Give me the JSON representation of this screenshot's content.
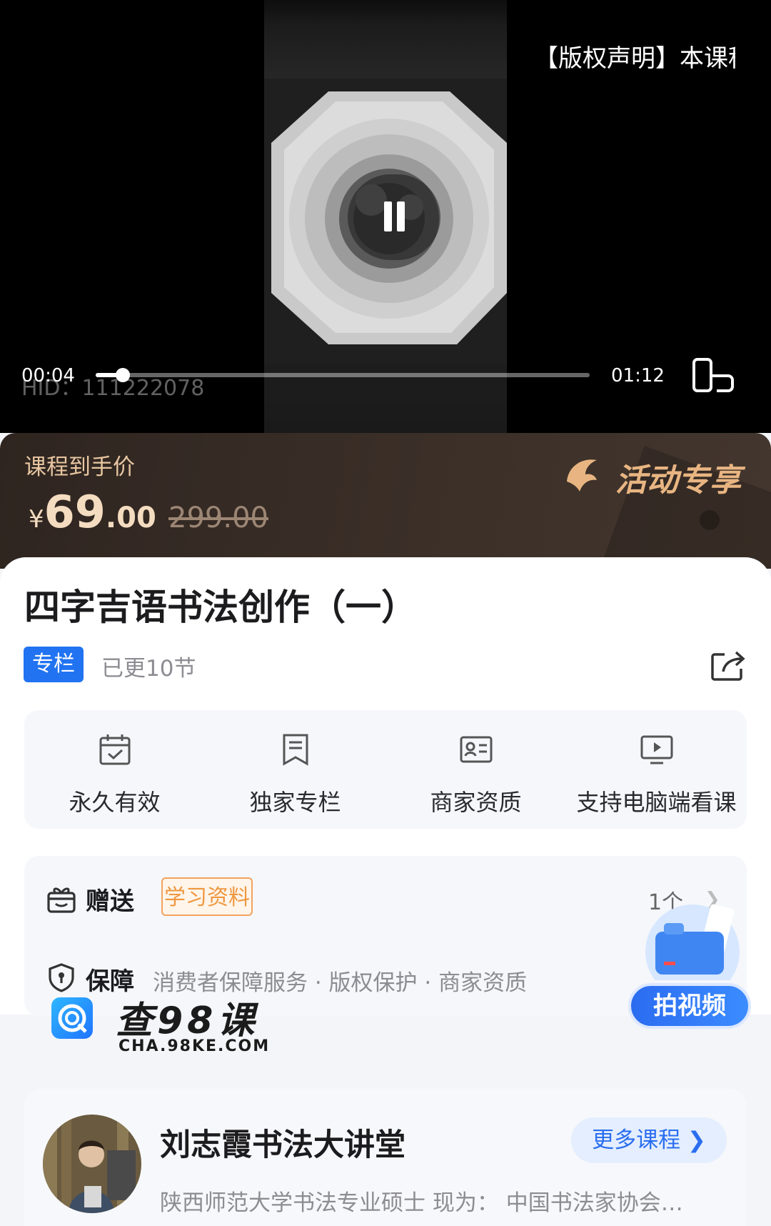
{
  "player": {
    "copyright_notice": "【版权声明】本课程",
    "watermark_id": "HID：111222078",
    "current_time": "00:04",
    "total_time": "01:12",
    "progress_fraction": 0.055
  },
  "price": {
    "label": "课程到手价",
    "currency": "¥",
    "integer": "69",
    "decimal": ".00",
    "original": "299.00",
    "activity_badge": "活动专享"
  },
  "course": {
    "title": "四字吉语书法创作（一）",
    "tag": "专栏",
    "updated": "已更10节"
  },
  "features": [
    {
      "label": "永久有效",
      "icon": "calendar-check-icon"
    },
    {
      "label": "独家专栏",
      "icon": "bookmark-icon"
    },
    {
      "label": "商家资质",
      "icon": "id-card-icon"
    },
    {
      "label": "支持电脑端看课",
      "icon": "monitor-play-icon"
    }
  ],
  "gift": {
    "label": "赠送",
    "tag": "学习资料",
    "count": "1个"
  },
  "guarantee": {
    "label": "保障",
    "items": "消费者保障服务 · 版权保护 · 商家资质"
  },
  "floating_button": {
    "label": "拍视频"
  },
  "site_watermark": {
    "name": "查98课",
    "url": "CHA.98KE.COM"
  },
  "teacher": {
    "name": "刘志霞书法大讲堂",
    "more_label": "更多课程",
    "description": "陕西师范大学书法专业硕士 现为：  中国书法家协会…"
  },
  "colors": {
    "accent_blue": "#2173f1",
    "price_gold": "#f4dcc0",
    "gift_orange": "#ef9740"
  }
}
